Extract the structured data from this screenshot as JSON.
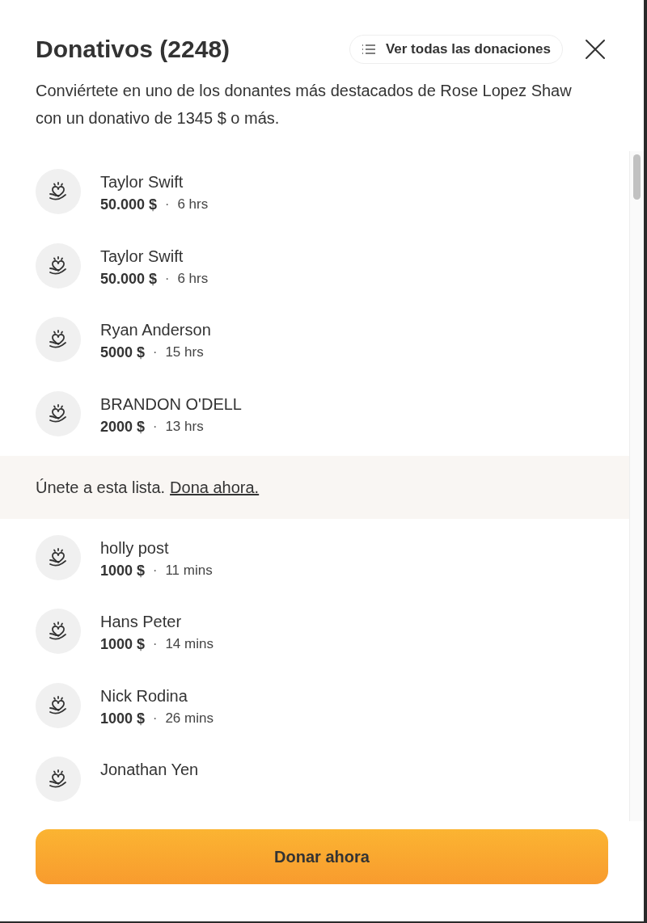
{
  "dialog": {
    "title": "Donativos (2248)",
    "view_all_button": "Ver todas las donaciones",
    "description": "Conviértete en uno de los donantes más destacados de Rose Lopez Shaw con un donativo de 1345 $ o más."
  },
  "top_donors": [
    {
      "name": "Taylor Swift",
      "amount": "50.000 $",
      "separator": "·",
      "time": "6 hrs"
    },
    {
      "name": "Taylor Swift",
      "amount": "50.000 $",
      "separator": "·",
      "time": "6 hrs"
    },
    {
      "name": "Ryan Anderson",
      "amount": "5000 $",
      "separator": "·",
      "time": "15 hrs"
    },
    {
      "name": "BRANDON O'DELL",
      "amount": "2000 $",
      "separator": "·",
      "time": "13 hrs"
    }
  ],
  "join_banner": {
    "text": "Únete a esta lista.",
    "link": "Dona ahora."
  },
  "recent_donors": [
    {
      "name": "holly post",
      "amount": "1000 $",
      "separator": "·",
      "time": "11 mins"
    },
    {
      "name": "Hans Peter",
      "amount": "1000 $",
      "separator": "·",
      "time": "14 mins"
    },
    {
      "name": "Nick Rodina",
      "amount": "1000 $",
      "separator": "·",
      "time": "26 mins"
    },
    {
      "name": "Jonathan Yen"
    }
  ],
  "donate_button": "Donar ahora"
}
